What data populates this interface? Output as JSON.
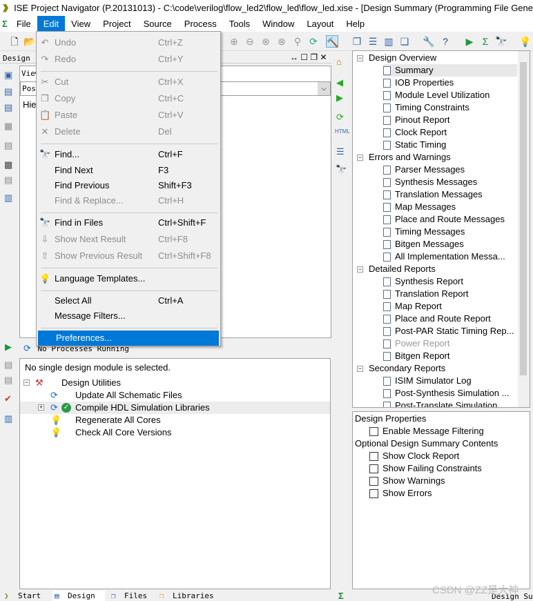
{
  "window": {
    "title": "ISE Project Navigator (P.20131013) - C:\\code\\verilog\\flow_led2\\flow_led\\flow_led.xise - [Design Summary (Programming File Gene"
  },
  "menubar": [
    "File",
    "Edit",
    "View",
    "Project",
    "Source",
    "Process",
    "Tools",
    "Window",
    "Layout",
    "Help"
  ],
  "edit_menu": [
    {
      "label": "Undo",
      "shortcut": "Ctrl+Z",
      "icon": "undo-icon",
      "glyph": "↶",
      "disabled": true
    },
    {
      "label": "Redo",
      "shortcut": "Ctrl+Y",
      "icon": "redo-icon",
      "glyph": "↷",
      "disabled": true
    },
    {
      "sep": true
    },
    {
      "label": "Cut",
      "shortcut": "Ctrl+X",
      "icon": "scissors-icon",
      "glyph": "✂",
      "disabled": true
    },
    {
      "label": "Copy",
      "shortcut": "Ctrl+C",
      "icon": "copy-icon",
      "glyph": "❐",
      "disabled": true
    },
    {
      "label": "Paste",
      "shortcut": "Ctrl+V",
      "icon": "paste-icon",
      "glyph": "📋",
      "disabled": true
    },
    {
      "label": "Delete",
      "shortcut": "Del",
      "icon": "delete-icon",
      "glyph": "✕",
      "disabled": true
    },
    {
      "sep": true
    },
    {
      "label": "Find...",
      "shortcut": "Ctrl+F",
      "icon": "binoculars-icon",
      "glyph": "🔭",
      "disabled": false
    },
    {
      "label": "Find Next",
      "shortcut": "F3",
      "disabled": false
    },
    {
      "label": "Find Previous",
      "shortcut": "Shift+F3",
      "disabled": false
    },
    {
      "label": "Find & Replace...",
      "shortcut": "Ctrl+H",
      "disabled": true
    },
    {
      "sep": true
    },
    {
      "label": "Find in Files",
      "shortcut": "Ctrl+Shift+F",
      "icon": "find-in-files-icon",
      "glyph": "🔭",
      "disabled": false
    },
    {
      "label": "Show Next Result",
      "shortcut": "Ctrl+F8",
      "icon": "arrow-down-icon",
      "glyph": "⇩",
      "disabled": true
    },
    {
      "label": "Show Previous Result",
      "shortcut": "Ctrl+Shift+F8",
      "icon": "arrow-up-icon",
      "glyph": "⇧",
      "disabled": true
    },
    {
      "sep": true
    },
    {
      "label": "Language Templates...",
      "icon": "lightbulb-icon",
      "glyph": "💡",
      "disabled": false
    },
    {
      "sep": true
    },
    {
      "label": "Select All",
      "shortcut": "Ctrl+A",
      "disabled": false
    },
    {
      "label": "Message Filters...",
      "disabled": false
    },
    {
      "sep": true
    },
    {
      "label": "Preferences...",
      "disabled": false,
      "highlighted": true
    }
  ],
  "design_panel": {
    "header": "Design",
    "view_label": "View",
    "dropdown_value": "Post",
    "hier_label": "Hie"
  },
  "processes": {
    "status": "No Processes Running",
    "message": "No single design module is selected.",
    "items": [
      {
        "label": "Design Utilities",
        "level": 0,
        "expander": "−"
      },
      {
        "label": "Update All Schematic Files",
        "level": 1
      },
      {
        "label": "Compile HDL Simulation Libraries",
        "level": 1,
        "expander": "+",
        "status": "ok"
      },
      {
        "label": "Regenerate All Cores",
        "level": 1
      },
      {
        "label": "Check All Core Versions",
        "level": 1
      }
    ]
  },
  "summary_tree": [
    {
      "label": "Design Overview",
      "group": true
    },
    {
      "label": "Summary",
      "selected": true
    },
    {
      "label": "IOB Properties"
    },
    {
      "label": "Module Level Utilization"
    },
    {
      "label": "Timing Constraints"
    },
    {
      "label": "Pinout Report"
    },
    {
      "label": "Clock Report"
    },
    {
      "label": "Static Timing"
    },
    {
      "label": "Errors and Warnings",
      "group": true
    },
    {
      "label": "Parser Messages"
    },
    {
      "label": "Synthesis Messages"
    },
    {
      "label": "Translation Messages"
    },
    {
      "label": "Map Messages"
    },
    {
      "label": "Place and Route Messages"
    },
    {
      "label": "Timing Messages"
    },
    {
      "label": "Bitgen Messages"
    },
    {
      "label": "All Implementation Messa..."
    },
    {
      "label": "Detailed Reports",
      "group": true
    },
    {
      "label": "Synthesis Report"
    },
    {
      "label": "Translation Report"
    },
    {
      "label": "Map Report"
    },
    {
      "label": "Place and Route Report"
    },
    {
      "label": "Post-PAR Static Timing Rep..."
    },
    {
      "label": "Power Report",
      "disabled": true
    },
    {
      "label": "Bitgen Report"
    },
    {
      "label": "Secondary Reports",
      "group": true
    },
    {
      "label": "ISIM Simulator Log"
    },
    {
      "label": "Post-Synthesis Simulation ..."
    },
    {
      "label": "Post-Translate Simulation"
    }
  ],
  "design_properties": [
    {
      "label": "Design Properties",
      "group": true
    },
    {
      "label": "Enable Message Filtering",
      "checked": false
    },
    {
      "label": "Optional Design Summary Contents",
      "group": true
    },
    {
      "label": "Show Clock Report",
      "checked": false
    },
    {
      "label": "Show Failing Constraints",
      "checked": false
    },
    {
      "label": "Show Warnings",
      "checked": false
    },
    {
      "label": "Show Errors",
      "checked": false
    }
  ],
  "bottom_tabs": [
    "Start",
    "Design",
    "Files",
    "Libraries"
  ],
  "bottom_right_tab": "Design Sum",
  "watermark": "CSDN @ZZ是大神",
  "colors": {
    "highlight": "#0078d7",
    "selected_row": "#e8e8e8"
  }
}
